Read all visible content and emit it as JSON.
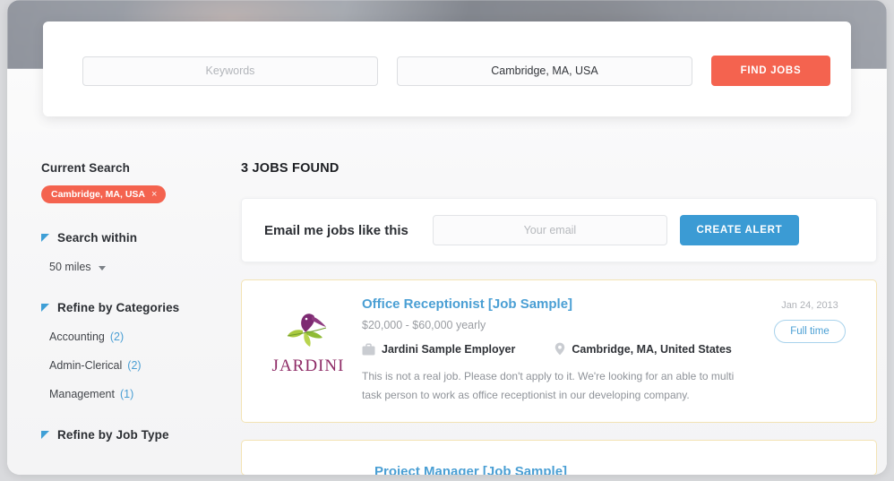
{
  "search_bar": {
    "keywords_placeholder": "Keywords",
    "location_value": "Cambridge, MA, USA",
    "find_jobs_label": "FIND JOBS",
    "accent_color": "#f4634f"
  },
  "sidebar": {
    "current_search_title": "Current Search",
    "current_search_tag": "Cambridge, MA, USA",
    "tag_close_icon": "×",
    "search_within": {
      "title": "Search within",
      "selected": "50 miles"
    },
    "categories": {
      "title": "Refine by Categories",
      "items": [
        {
          "label": "Accounting",
          "count": "(2)"
        },
        {
          "label": "Admin-Clerical",
          "count": "(2)"
        },
        {
          "label": "Management",
          "count": "(1)"
        }
      ]
    },
    "job_type": {
      "title": "Refine by Job Type"
    }
  },
  "main": {
    "results_heading": "3 JOBS FOUND",
    "alert": {
      "label": "Email me jobs like this",
      "email_placeholder": "Your email",
      "button_label": "CREATE ALERT",
      "button_color": "#3b9bd4"
    },
    "jobs": [
      {
        "logo_text": "JARDINI",
        "title": "Office Receptionist [Job Sample]",
        "salary": "$20,000 - $60,000 yearly",
        "employer": "Jardini Sample Employer",
        "location": "Cambridge, MA, United States",
        "description": "This is not a real job. Please don't apply to it. We're looking for an able to multi task person to work as office receptionist in our developing company.",
        "date": "Jan 24, 2013",
        "job_type": "Full time"
      }
    ],
    "next_job_title": "Project Manager [Job Sample]"
  }
}
